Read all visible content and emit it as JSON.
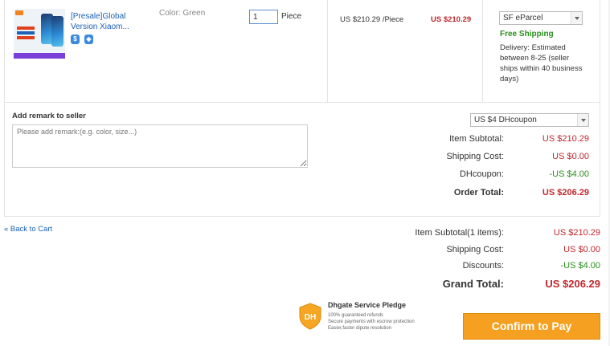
{
  "product": {
    "title": "[Presale]Global Version Xiaom...",
    "color_label": "Color:",
    "color_value": "Green",
    "quantity": "1",
    "unit": "Piece",
    "unit_price": "US $210.29 /Piece",
    "line_total": "US $210.29"
  },
  "shipping": {
    "method": "SF eParcel",
    "free_label": "Free Shipping",
    "delivery_text": "Delivery: Estimated between 8-25 (seller ships within 40 business days)"
  },
  "remark": {
    "label": "Add remark to seller",
    "placeholder": "Please add remark:(e.g. color, size...)"
  },
  "coupon": {
    "selected": "US $4 DHcoupon"
  },
  "seller_summary": {
    "item_subtotal_label": "Item Subtotal:",
    "item_subtotal": "US $210.29",
    "shipping_cost_label": "Shipping Cost:",
    "shipping_cost": "US $0.00",
    "dhcoupon_label": "DHcoupon:",
    "dhcoupon": "-US $4.00",
    "order_total_label": "Order Total:",
    "order_total": "US $206.29"
  },
  "back_link": "« Back to Cart",
  "grand_summary": {
    "item_subtotal_label": "Item Subtotal(1 items):",
    "item_subtotal": "US $210.29",
    "shipping_cost_label": "Shipping Cost:",
    "shipping_cost": "US $0.00",
    "discounts_label": "Discounts:",
    "discounts": "-US $4.00",
    "grand_total_label": "Grand Total:",
    "grand_total": "US $206.29"
  },
  "pledge": {
    "title": "Dhgate Service Pledge",
    "line1": "100% guaranteed refunds",
    "line2": "Secure payments with escrow protection",
    "line3": "Easier,faster dipute resolution"
  },
  "pay_button": "Confirm to Pay",
  "colors": {
    "accent_orange": "#f5a020",
    "price_red": "#c0282d",
    "free_green": "#2a8f1d",
    "link_blue": "#1a5fb4"
  }
}
